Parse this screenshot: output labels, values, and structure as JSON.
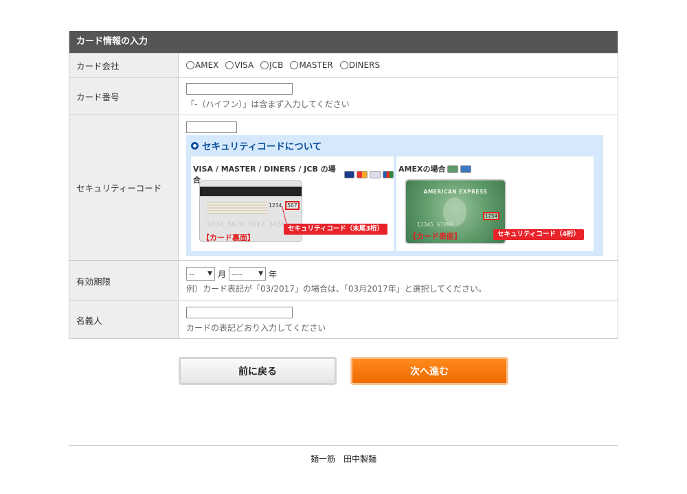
{
  "form": {
    "title": "カード情報の入力",
    "company": {
      "label": "カード会社",
      "options": [
        "AMEX",
        "VISA",
        "JCB",
        "MASTER",
        "DINERS"
      ]
    },
    "number": {
      "label": "カード番号",
      "hint": "「-（ハイフン）」は含まず入力してください"
    },
    "security": {
      "label": "セキュリティーコード",
      "info_title": "セキュリティコードについて",
      "panel_a": {
        "title": "VISA / MASTER / DINERS / JCB の場合",
        "digits_prefix": "1234",
        "digits_code": "567",
        "card_number": "1234  5678 9012 3456",
        "card_tag": "【カード裏面】",
        "callout": "セキュリティコード（末尾3桁）"
      },
      "panel_b": {
        "title": "AMEXの場合",
        "brand": "AMERICAN EXPRESS",
        "card_code": "1234",
        "card_number": "12345      67890",
        "card_tag": "【カード表面】",
        "callout": "セキュリティコード（4桁）"
      }
    },
    "expiry": {
      "label": "有効期限",
      "month_value": "--",
      "month_unit": "月",
      "year_value": "----",
      "year_unit": "年",
      "hint": "例）カード表記が「03/2017」の場合は、「03月2017年」と選択してください。"
    },
    "holder": {
      "label": "名義人",
      "hint": "カードの表記どおり入力してください"
    }
  },
  "buttons": {
    "back": "前に戻る",
    "next": "次へ進む"
  },
  "footer": {
    "text": "麺一筋　田中製麺"
  },
  "colors": {
    "title_bar": "#555555",
    "accent_blue": "#0b4f9c",
    "next_button": "#f06a00",
    "callout_red": "#e8232a"
  }
}
